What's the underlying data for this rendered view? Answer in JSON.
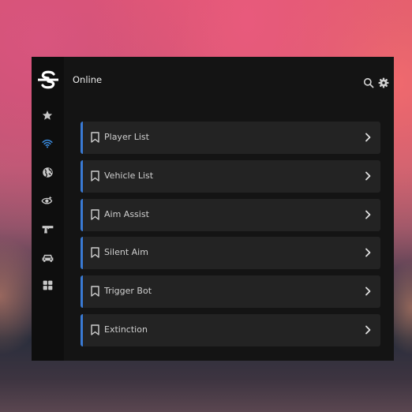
{
  "header": {
    "title": "Online"
  },
  "header_icons": {
    "search": "search-icon",
    "settings": "gear-icon"
  },
  "sidebar": {
    "logo": "s-logo",
    "items": [
      {
        "icon": "star-icon",
        "active": false
      },
      {
        "icon": "wifi-icon",
        "active": true
      },
      {
        "icon": "globe-icon",
        "active": false
      },
      {
        "icon": "eye-target-icon",
        "active": false
      },
      {
        "icon": "gun-icon",
        "active": false
      },
      {
        "icon": "car-icon",
        "active": false
      },
      {
        "icon": "grid-icon",
        "active": false
      }
    ]
  },
  "menu": {
    "items": [
      {
        "label": "Player List"
      },
      {
        "label": "Vehicle List"
      },
      {
        "label": "Aim Assist"
      },
      {
        "label": "Silent Aim"
      },
      {
        "label": "Trigger Bot"
      },
      {
        "label": "Extinction"
      }
    ]
  },
  "colors": {
    "accent": "#3a7bd5",
    "panel": "#141414",
    "item": "#232323",
    "sidebar": "#0e0e0e"
  }
}
